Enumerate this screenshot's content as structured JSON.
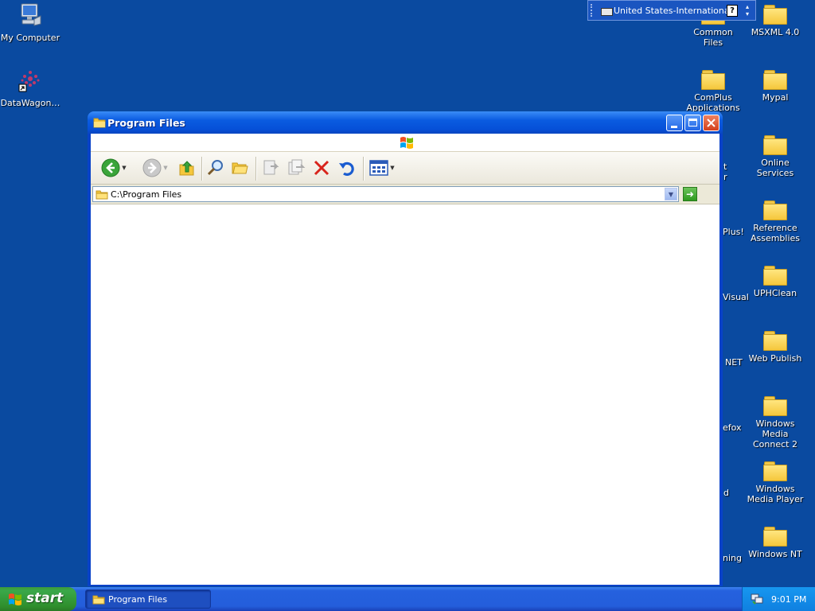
{
  "desktop": {
    "left_icons": [
      {
        "label": "My Computer",
        "icon": "my-computer-icon"
      },
      {
        "label": "DataWagon…",
        "icon": "datawagon-shortcut-icon"
      }
    ],
    "right_col1": [
      {
        "label": "Common Files"
      },
      {
        "label": "ComPlus Applications"
      }
    ],
    "right_col2": [
      {
        "label": "MSXML 4.0"
      },
      {
        "label": "Mypal"
      },
      {
        "label": "Online Services"
      },
      {
        "label": "Reference Assemblies"
      },
      {
        "label": "UPHClean"
      },
      {
        "label": "Web Publish"
      },
      {
        "label": "Windows Media Connect 2"
      },
      {
        "label": "Windows Media Player"
      },
      {
        "label": "Windows NT"
      }
    ],
    "partial_labels": [
      "t",
      "r",
      "Plus!",
      "Visual",
      "NET",
      "efox",
      "d",
      "ning"
    ]
  },
  "language_bar": {
    "label": "United States-International",
    "help": "?"
  },
  "window": {
    "title": "Program Files",
    "address": "C:\\Program Files",
    "buttons": {
      "minimize": "minimize",
      "maximize": "maximize",
      "close": "close"
    }
  },
  "taskbar": {
    "start_label": "start",
    "items": [
      {
        "label": "Program Files"
      }
    ],
    "clock": "9:01 PM"
  },
  "colors": {
    "desktop": "#0a4aa0",
    "titlebar": "#0a5be0",
    "taskbar": "#245edb",
    "start": "#3aa84a"
  }
}
